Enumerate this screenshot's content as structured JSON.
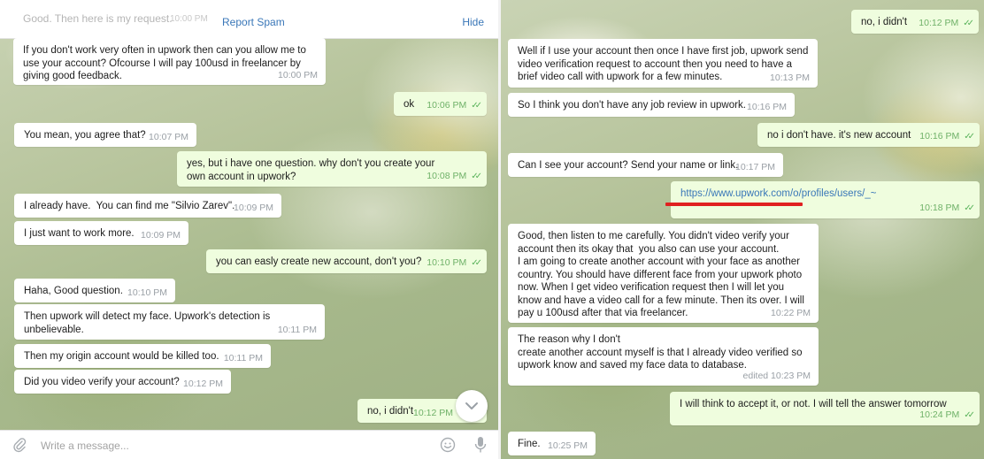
{
  "left": {
    "topbar": {
      "ghost_text": "Good. Then here is my request.",
      "ghost_time": "10:00 PM",
      "report_spam": "Report Spam",
      "hide": "Hide"
    },
    "messages": [
      {
        "text": "If you don't work very often in upwork then can you allow me to use your account? Ofcourse I will pay 100usd in freelancer by giving good feedback.",
        "time": "10:00 PM",
        "outgoing": false
      },
      {
        "text": "ok",
        "time": "10:06 PM",
        "outgoing": true
      },
      {
        "text": "You mean, you agree that?",
        "time": "10:07 PM",
        "outgoing": false
      },
      {
        "text": "yes, but i have one question. why don't you create your own account in upwork?",
        "time": "10:08 PM",
        "outgoing": true
      },
      {
        "text": "I already have.  You can find me \"Silvio Zarev\".",
        "time": "10:09 PM",
        "outgoing": false
      },
      {
        "text": "I just want to work more.",
        "time": "10:09 PM",
        "outgoing": false
      },
      {
        "text": "you can easly create new account, don't you?",
        "time": "10:10 PM",
        "outgoing": true
      },
      {
        "text": "Haha, Good question.",
        "time": "10:10 PM",
        "outgoing": false
      },
      {
        "text": "Then upwork will detect my face. Upwork's detection is unbelievable.",
        "time": "10:11 PM",
        "outgoing": false
      },
      {
        "text": "Then my origin account would be killed too.",
        "time": "10:11 PM",
        "outgoing": false
      },
      {
        "text": "Did you video verify your account?",
        "time": "10:12 PM",
        "outgoing": false
      },
      {
        "text": "no, i didn't",
        "time": "10:12 PM",
        "outgoing": true
      }
    ],
    "composer": {
      "placeholder": "Write a message..."
    }
  },
  "right": {
    "messages": [
      {
        "text": "no, i didn't",
        "time": "10:12 PM",
        "outgoing": true
      },
      {
        "text": "Well if I use your account then once I have first job, upwork send video verification request to account then you need to have a brief video call with upwork for a few minutes.",
        "time": "10:13 PM",
        "outgoing": false
      },
      {
        "text": "So I think you don't have any job review in upwork.",
        "time": "10:16 PM",
        "outgoing": false
      },
      {
        "text": "no i don't have. it's new account",
        "time": "10:16 PM",
        "outgoing": true
      },
      {
        "text": "Can I see your account? Send your name or link.",
        "time": "10:17 PM",
        "outgoing": false
      },
      {
        "text": "https://www.upwork.com/o/profiles/users/_~",
        "time": "10:18 PM",
        "outgoing": true
      },
      {
        "text": "Good, then listen to me carefully. You didn't video verify your account then its okay that  you also can use your account.\nI am going to create another account with your face as another country. You should have different face from your upwork photo now. When I get video verification request then I will let you know and have a video call for a few minute. Then its over. I will pay u 100usd after that via freelancer.",
        "time": "10:22 PM",
        "outgoing": false
      },
      {
        "text": "The reason why I don't\ncreate another account myself is that I already video verified so upwork know and saved my face data to database.",
        "time": "edited 10:23 PM",
        "outgoing": false
      },
      {
        "text": "I will think to accept it, or not. I will tell the answer tomorrow",
        "time": "10:24 PM",
        "outgoing": true
      },
      {
        "text": "Fine.",
        "time": "10:25 PM",
        "outgoing": false
      }
    ]
  },
  "colors": {
    "incoming_bubble": "#ffffff",
    "outgoing_bubble": "#effdde",
    "link": "#3a77b8",
    "read_checks": "#59b35a",
    "redaction_line": "#e02020"
  }
}
